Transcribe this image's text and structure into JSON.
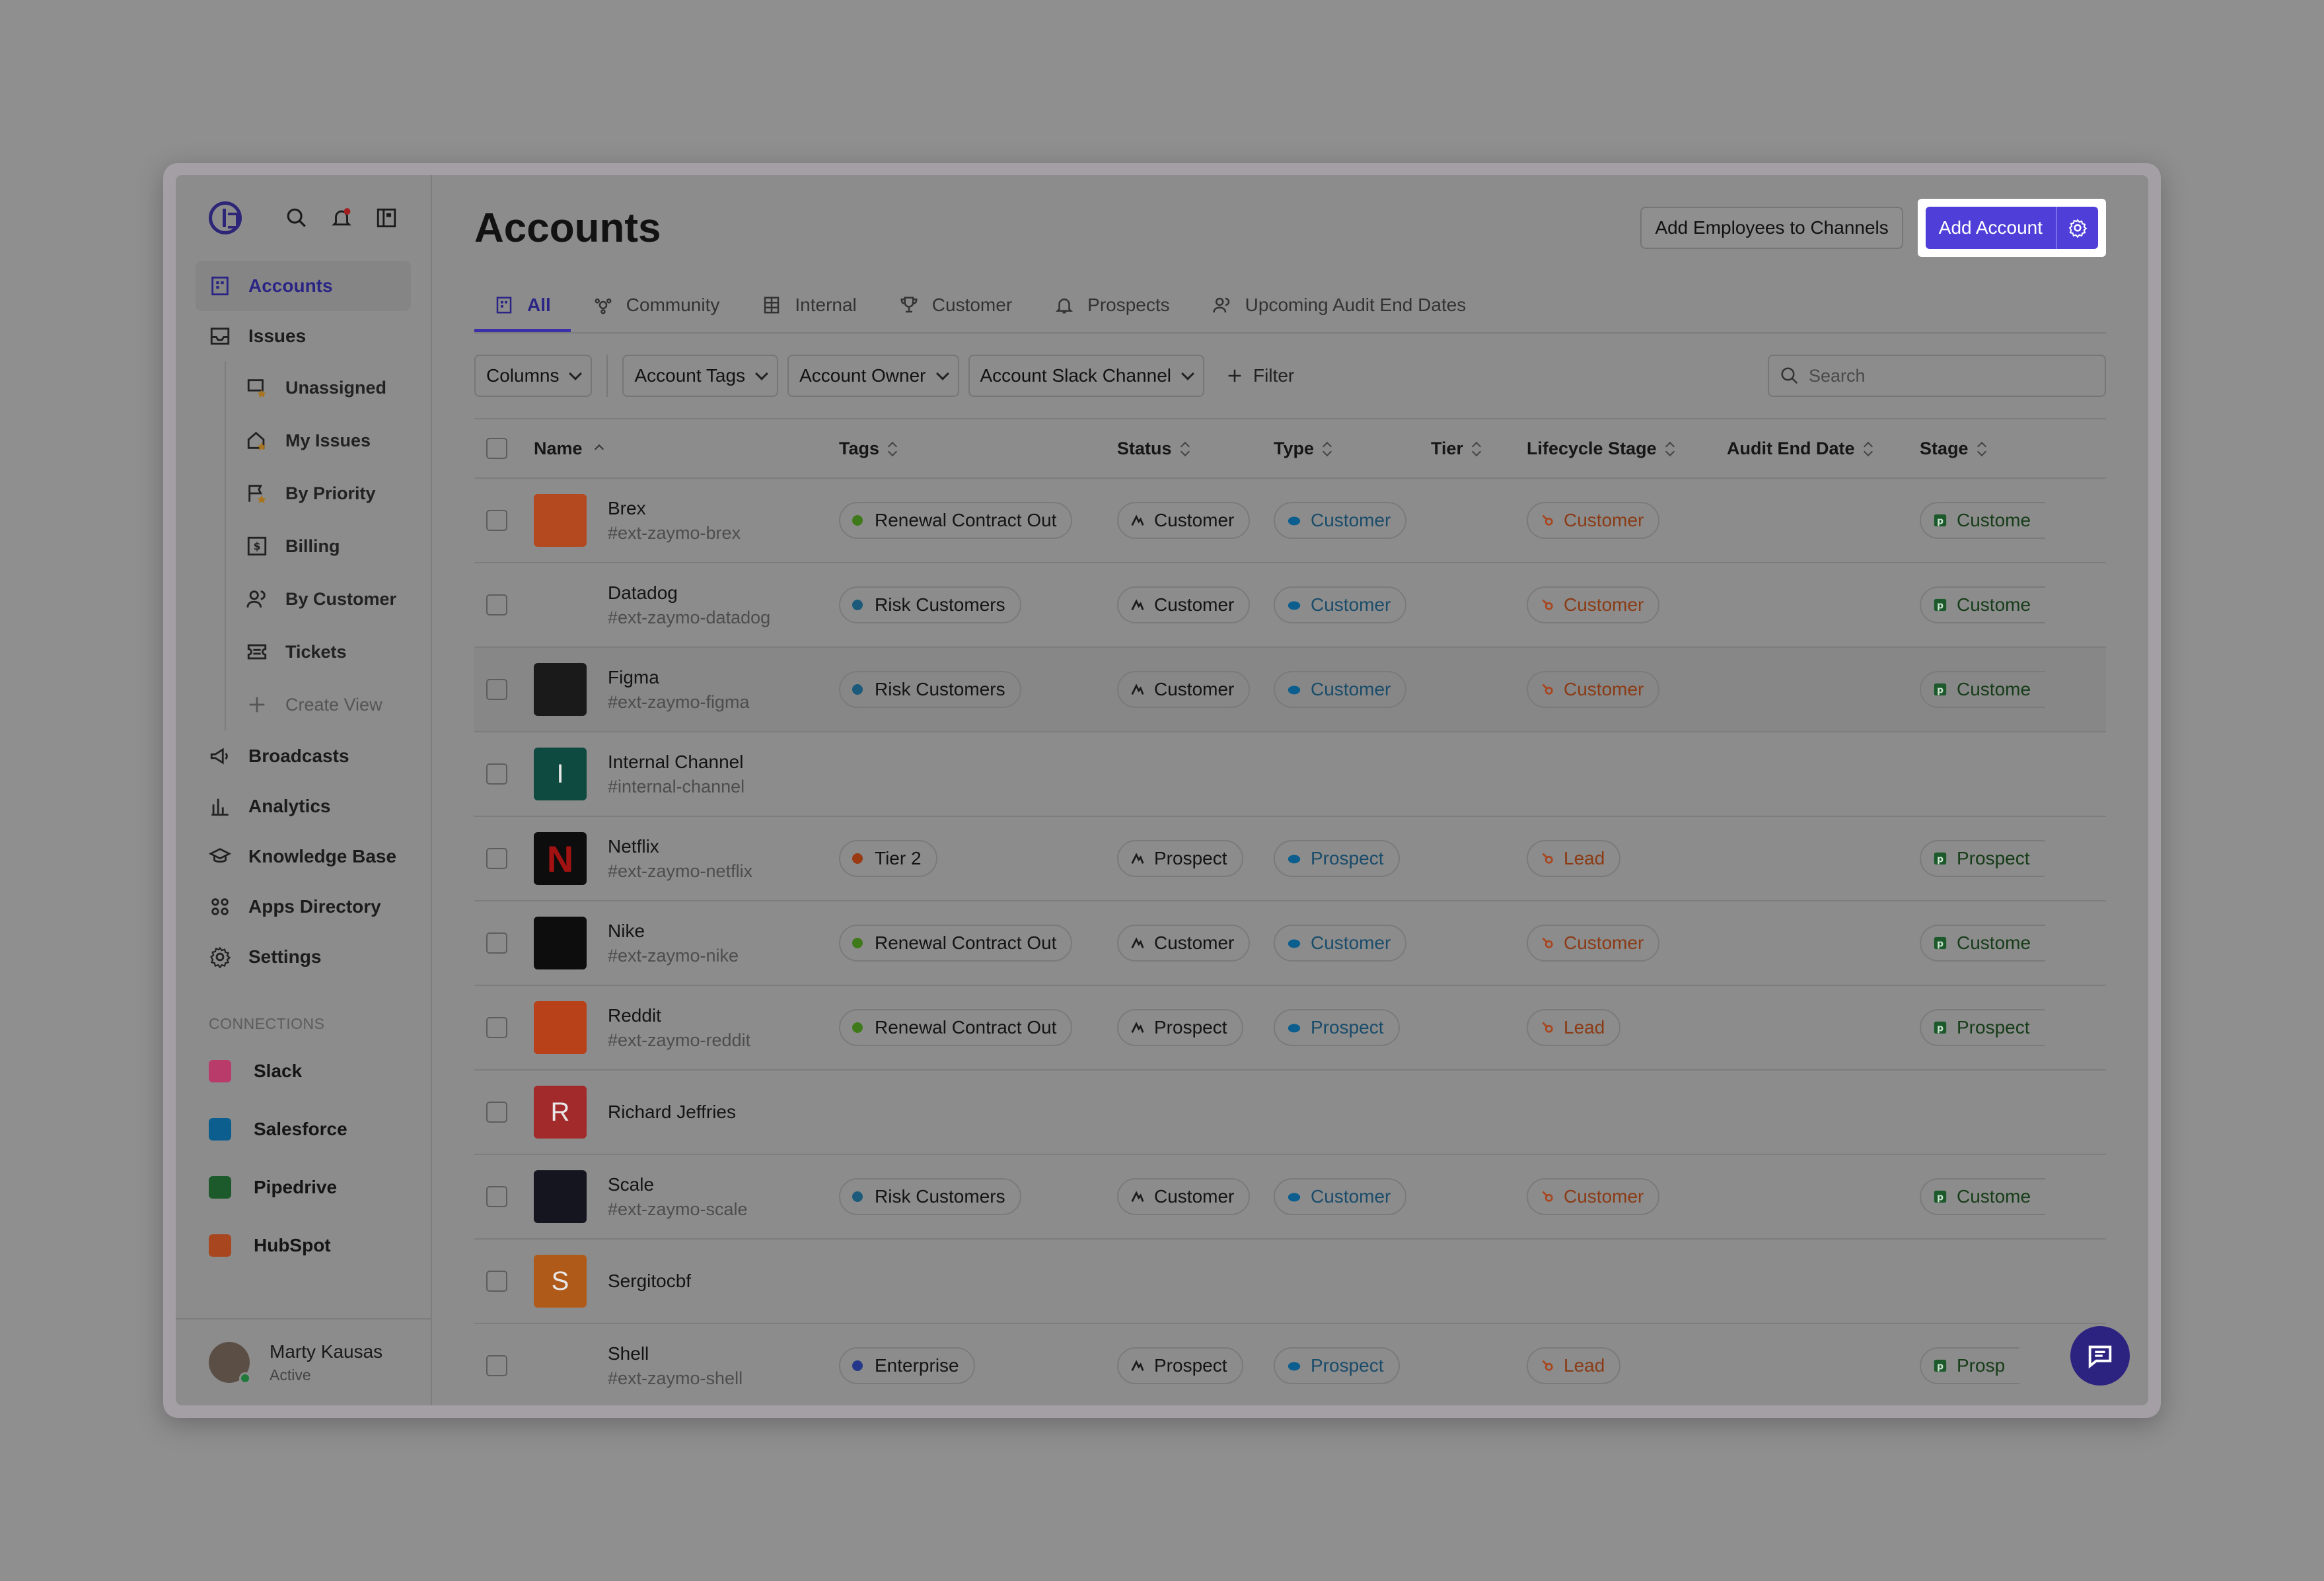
{
  "sidebar": {
    "nav_top": [
      {
        "label": "Accounts",
        "icon": "building-icon",
        "active": true
      },
      {
        "label": "Issues",
        "icon": "inbox-icon",
        "active": false
      }
    ],
    "issue_views": [
      {
        "label": "Unassigned",
        "icon": "unassigned-icon"
      },
      {
        "label": "My Issues",
        "icon": "my-issues-icon"
      },
      {
        "label": "By Priority",
        "icon": "priority-flag-icon"
      },
      {
        "label": "Billing",
        "icon": "billing-icon"
      },
      {
        "label": "By Customer",
        "icon": "users-icon"
      },
      {
        "label": "Tickets",
        "icon": "ticket-icon"
      }
    ],
    "create_view": "Create View",
    "nav_bottom": [
      {
        "label": "Broadcasts",
        "icon": "megaphone-icon"
      },
      {
        "label": "Analytics",
        "icon": "bar-chart-icon"
      },
      {
        "label": "Knowledge Base",
        "icon": "graduation-cap-icon"
      },
      {
        "label": "Apps Directory",
        "icon": "apps-grid-icon"
      },
      {
        "label": "Settings",
        "icon": "gear-icon"
      }
    ],
    "connections_label": "CONNECTIONS",
    "connections": [
      {
        "label": "Slack",
        "color": "#b83b6a"
      },
      {
        "label": "Salesforce",
        "color": "#0b5e8e"
      },
      {
        "label": "Pipedrive",
        "color": "#1c5a2c"
      },
      {
        "label": "HubSpot",
        "color": "#a8461f"
      }
    ],
    "user": {
      "name": "Marty Kausas",
      "status": "Active"
    }
  },
  "header": {
    "title": "Accounts",
    "add_employees_label": "Add Employees to Channels",
    "add_account_label": "Add Account"
  },
  "tabs": [
    {
      "label": "All",
      "icon": "building-icon",
      "active": true
    },
    {
      "label": "Community",
      "icon": "community-icon",
      "active": false
    },
    {
      "label": "Internal",
      "icon": "building-grid-icon",
      "active": false
    },
    {
      "label": "Customer",
      "icon": "trophy-icon",
      "active": false
    },
    {
      "label": "Prospects",
      "icon": "bell-icon",
      "active": false
    },
    {
      "label": "Upcoming Audit End Dates",
      "icon": "users-icon",
      "active": false
    }
  ],
  "filters": {
    "columns": "Columns",
    "account_tags": "Account Tags",
    "account_owner": "Account Owner",
    "account_slack_channel": "Account Slack Channel",
    "filter": "Filter",
    "search_placeholder": "Search"
  },
  "table": {
    "headers": [
      "Name",
      "Tags",
      "Status",
      "Type",
      "Tier",
      "Lifecycle Stage",
      "Audit End Date",
      "Stage"
    ],
    "rows": [
      {
        "name": "Brex",
        "slug": "#ext-zaymo-brex",
        "logo_color": "#b4481f",
        "logo_text": "",
        "tag": "Renewal Contract Out",
        "tag_color": "#3f7a1a",
        "status": "Customer",
        "type": "Customer",
        "tier": "",
        "lifecycle": "Customer",
        "audit_end": "",
        "stage": "Custome",
        "hl": false
      },
      {
        "name": "Datadog",
        "slug": "#ext-zaymo-datadog",
        "logo_color": "#8c8c8c",
        "logo_text": "",
        "tag": "Risk Customers",
        "tag_color": "#1b5a7a",
        "status": "Customer",
        "type": "Customer",
        "tier": "",
        "lifecycle": "Customer",
        "audit_end": "",
        "stage": "Custome",
        "hl": false
      },
      {
        "name": "Figma",
        "slug": "#ext-zaymo-figma",
        "logo_color": "#1a1a1a",
        "logo_text": "",
        "tag": "Risk Customers",
        "tag_color": "#1b5a7a",
        "status": "Customer",
        "type": "Customer",
        "tier": "",
        "lifecycle": "Customer",
        "audit_end": "",
        "stage": "Custome",
        "hl": true
      },
      {
        "name": "Internal Channel",
        "slug": "#internal-channel",
        "logo_color": "#0f4a40",
        "logo_text": "I",
        "tag": "",
        "tag_color": "",
        "status": "",
        "type": "",
        "tier": "",
        "lifecycle": "",
        "audit_end": "",
        "stage": "",
        "hl": false
      },
      {
        "name": "Netflix",
        "slug": "#ext-zaymo-netflix",
        "logo_color": "#0d0d0d",
        "logo_text": "N",
        "tag": "Tier 2",
        "tag_color": "#9a3a12",
        "status": "Prospect",
        "type": "Prospect",
        "tier": "",
        "lifecycle": "Lead",
        "audit_end": "",
        "stage": "Prospect",
        "hl": false
      },
      {
        "name": "Nike",
        "slug": "#ext-zaymo-nike",
        "logo_color": "#0d0d0d",
        "logo_text": "",
        "tag": "Renewal Contract Out",
        "tag_color": "#3f7a1a",
        "status": "Customer",
        "type": "Customer",
        "tier": "",
        "lifecycle": "Customer",
        "audit_end": "",
        "stage": "Custome",
        "hl": false
      },
      {
        "name": "Reddit",
        "slug": "#ext-zaymo-reddit",
        "logo_color": "#b8411a",
        "logo_text": "",
        "tag": "Renewal Contract Out",
        "tag_color": "#3f7a1a",
        "status": "Prospect",
        "type": "Prospect",
        "tier": "",
        "lifecycle": "Lead",
        "audit_end": "",
        "stage": "Prospect",
        "hl": false
      },
      {
        "name": "Richard Jeffries",
        "slug": "",
        "logo_color": "#a32a2a",
        "logo_text": "R",
        "tag": "",
        "tag_color": "",
        "status": "",
        "type": "",
        "tier": "",
        "lifecycle": "",
        "audit_end": "",
        "stage": "",
        "hl": false
      },
      {
        "name": "Scale",
        "slug": "#ext-zaymo-scale",
        "logo_color": "#151520",
        "logo_text": "",
        "tag": "Risk Customers",
        "tag_color": "#1b5a7a",
        "status": "Customer",
        "type": "Customer",
        "tier": "",
        "lifecycle": "Customer",
        "audit_end": "",
        "stage": "Custome",
        "hl": false
      },
      {
        "name": "Sergitocbf",
        "slug": "",
        "logo_color": "#b05a1a",
        "logo_text": "S",
        "tag": "",
        "tag_color": "",
        "status": "",
        "type": "",
        "tier": "",
        "lifecycle": "",
        "audit_end": "",
        "stage": "",
        "hl": false
      },
      {
        "name": "Shell",
        "slug": "#ext-zaymo-shell",
        "logo_color": "#8c8c8c",
        "logo_text": "",
        "tag": "Enterprise",
        "tag_color": "#24378a",
        "status": "Prospect",
        "type": "Prospect",
        "tier": "",
        "lifecycle": "Lead",
        "audit_end": "",
        "stage": "Prosp",
        "hl": false
      }
    ]
  },
  "colors": {
    "accent": "#4f3fd8",
    "active_nav": "#2a2585"
  }
}
